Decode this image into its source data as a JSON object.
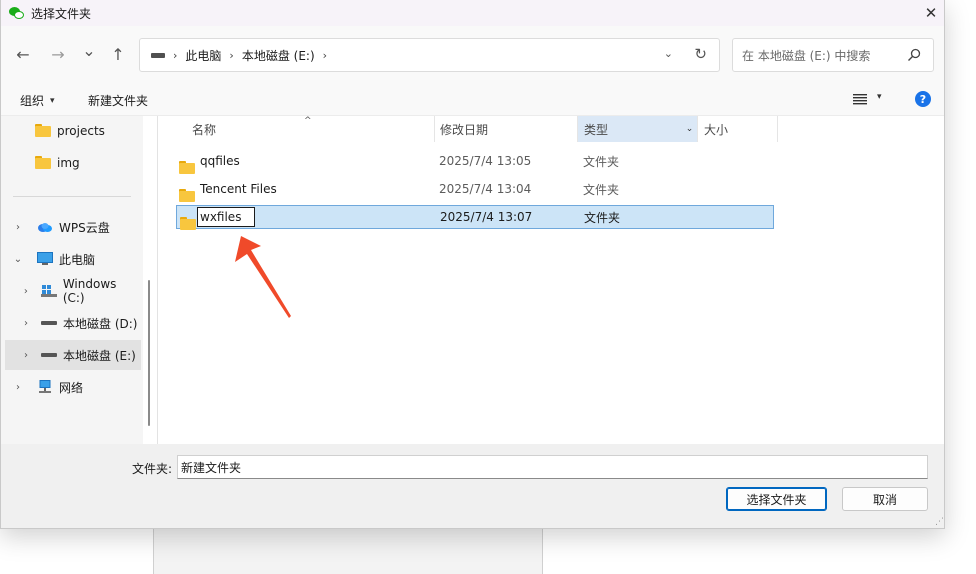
{
  "window": {
    "title": "选择文件夹",
    "close_glyph": "✕"
  },
  "nav": {
    "back_glyph": "←",
    "forward_glyph": "→",
    "recent_glyph": "⌄",
    "up_glyph": "↑",
    "breadcrumbs": [
      "此电脑",
      "本地磁盘 (E:)"
    ],
    "crumb_sep": "›",
    "dropdown_glyph": "⌄",
    "refresh_glyph": "↻",
    "search_placeholder": "在 本地磁盘 (E:) 中搜索"
  },
  "toolbar": {
    "organize_label": "组织",
    "new_folder_label": "新建文件夹",
    "caret": "▾",
    "help_glyph": "?"
  },
  "sidebar": {
    "items": [
      {
        "label": "projects",
        "icon": "folder-icon",
        "chevron": ""
      },
      {
        "label": "img",
        "icon": "folder-icon",
        "chevron": ""
      },
      {
        "label": "WPS云盘",
        "icon": "cloud-icon",
        "chevron": "›"
      },
      {
        "label": "此电脑",
        "icon": "computer-icon",
        "chevron": "⌄"
      },
      {
        "label": "Windows (C:)",
        "icon": "windows-drive-icon",
        "chevron": "›"
      },
      {
        "label": "本地磁盘 (D:)",
        "icon": "drive-icon",
        "chevron": "›"
      },
      {
        "label": "本地磁盘 (E:)",
        "icon": "drive-icon",
        "chevron": "›",
        "selected": true
      },
      {
        "label": "网络",
        "icon": "network-icon",
        "chevron": "›"
      }
    ]
  },
  "columns": {
    "name": "名称",
    "date": "修改日期",
    "type": "类型",
    "size": "大小",
    "sort_glyph": "^",
    "type_drop_glyph": "⌄"
  },
  "files": [
    {
      "name": "qqfiles",
      "date": "2025/7/4 13:05",
      "type": "文件夹"
    },
    {
      "name": "Tencent Files",
      "date": "2025/7/4 13:04",
      "type": "文件夹"
    },
    {
      "name": "wxfiles",
      "date": "2025/7/4 13:07",
      "type": "文件夹",
      "renaming": true
    }
  ],
  "footer": {
    "folder_label": "文件夹:",
    "folder_value": "新建文件夹",
    "select_button": "选择文件夹",
    "cancel_button": "取消"
  },
  "colors": {
    "accent": "#0067c0",
    "selection": "#cce4f7",
    "annotation_arrow": "#f04a2a",
    "folder": "#f8c63e"
  }
}
